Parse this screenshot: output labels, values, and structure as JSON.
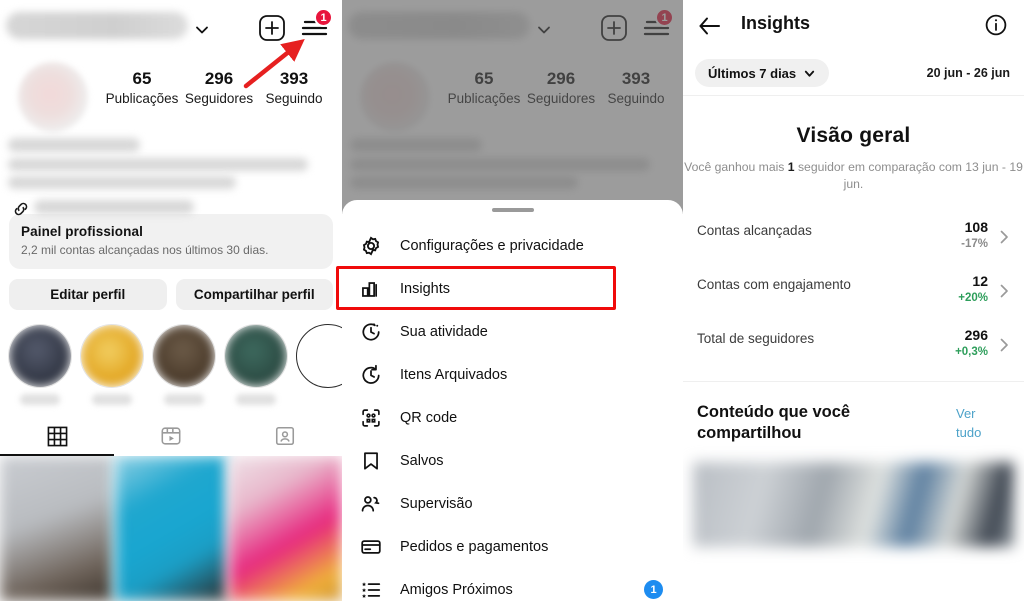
{
  "profile": {
    "stats": [
      {
        "num": "65",
        "label": "Publicações"
      },
      {
        "num": "296",
        "label": "Seguidores"
      },
      {
        "num": "393",
        "label": "Seguindo"
      }
    ],
    "burger_badge": "1",
    "professional_panel": {
      "title": "Painel profissional",
      "subtitle": "2,2 mil contas alcançadas nos últimos 30 dias."
    },
    "buttons": {
      "edit": "Editar perfil",
      "share": "Compartilhar perfil"
    },
    "highlight_colors": [
      "#3d4252",
      "#e3a822",
      "#4a3b2c",
      "#2c4a44"
    ],
    "icons": {
      "chevron": "chevron-down-icon",
      "plus": "new-post-icon",
      "burger": "hamburger-menu-icon",
      "link": "link-icon",
      "arrow": "red-arrow-annotation"
    },
    "tabs": [
      "grid-tab",
      "reels-tab",
      "tagged-tab"
    ]
  },
  "menu": {
    "stats": [
      {
        "num": "65",
        "label": "Publicações"
      },
      {
        "num": "296",
        "label": "Seguidores"
      },
      {
        "num": "393",
        "label": "Seguindo"
      }
    ],
    "burger_badge": "1",
    "items": [
      {
        "label": "Configurações e privacidade",
        "icon": "settings-gear-icon",
        "badge": ""
      },
      {
        "label": "Insights",
        "icon": "bar-chart-icon",
        "badge": ""
      },
      {
        "label": "Sua atividade",
        "icon": "activity-clock-icon",
        "badge": ""
      },
      {
        "label": "Itens Arquivados",
        "icon": "archive-clock-icon",
        "badge": ""
      },
      {
        "label": "QR code",
        "icon": "qr-code-icon",
        "badge": ""
      },
      {
        "label": "Salvos",
        "icon": "bookmark-icon",
        "badge": ""
      },
      {
        "label": "Supervisão",
        "icon": "supervision-icon",
        "badge": ""
      },
      {
        "label": "Pedidos e pagamentos",
        "icon": "credit-card-icon",
        "badge": ""
      },
      {
        "label": "Amigos Próximos",
        "icon": "close-friends-icon",
        "badge": "1"
      }
    ],
    "highlight_color": "#f00a0a"
  },
  "insights": {
    "title": "Insights",
    "period_pill": "Últimos 7 dias",
    "date_range": "20 jun - 26 jun",
    "overview_title": "Visão geral",
    "overview_note_before": "Você ganhou mais ",
    "overview_note_number": "1",
    "overview_note_after": " seguidor em comparação com 13 jun - 19 jun.",
    "metrics": [
      {
        "name": "Contas alcançadas",
        "value": "108",
        "delta": "-17%",
        "delta_dir": "flat"
      },
      {
        "name": "Contas com engajamento",
        "value": "12",
        "delta": "+20%",
        "delta_dir": "up"
      },
      {
        "name": "Total de seguidores",
        "value": "296",
        "delta": "+0,3%",
        "delta_dir": "up"
      }
    ],
    "section_title": "Conteúdo que você compartilhou",
    "section_link": "Ver tudo",
    "icons": {
      "back": "back-arrow-icon",
      "info": "info-circle-icon",
      "chevron": "chevron-right-icon",
      "pill_chevron": "chevron-down-icon"
    },
    "accent_link_color": "#4da2c9",
    "delta_up_color": "#2e9e5b"
  }
}
